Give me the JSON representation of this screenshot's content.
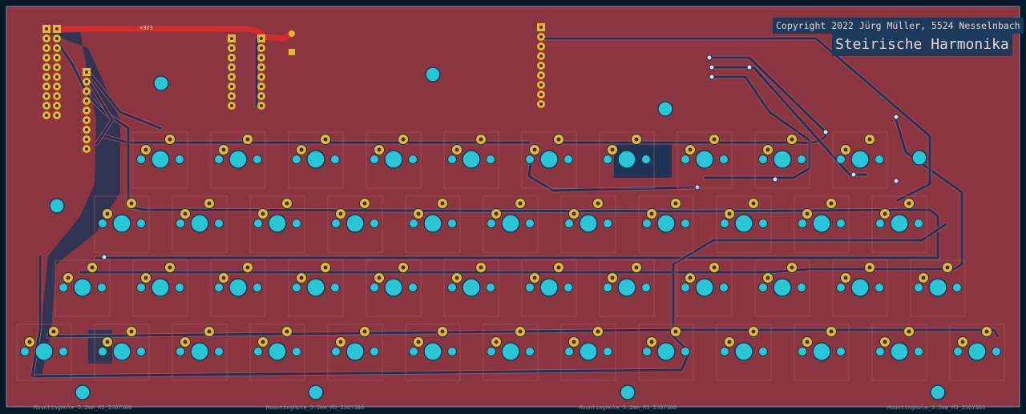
{
  "board": {
    "copyright": "Copyright 2022 Jürg Müller, 5524 Nesselnbach",
    "title": "Steirische Harmonika",
    "net_label": "+3V3",
    "mounting_hole_label": "MountingHole_3.2mm_M3_ISO7380",
    "colors": {
      "background": "#041a2a",
      "board_fill": "#8a3540",
      "trace": "#1d3456",
      "trace_outline": "#b04a57",
      "pad_gold": "#e6b82a",
      "hole_cyan": "#27c7d6",
      "power_trace": "#d42b2b",
      "silk": "#e6d5d5",
      "title_bg": "#1c3a5a"
    }
  },
  "rows": [
    {
      "name": "row1",
      "keys": 10,
      "extra_hole": true
    },
    {
      "name": "row2",
      "keys": 11,
      "extra_hole": false
    },
    {
      "name": "row3",
      "keys": 12,
      "extra_hole": false
    },
    {
      "name": "row4",
      "keys": 13,
      "extra_hole": false
    }
  ]
}
